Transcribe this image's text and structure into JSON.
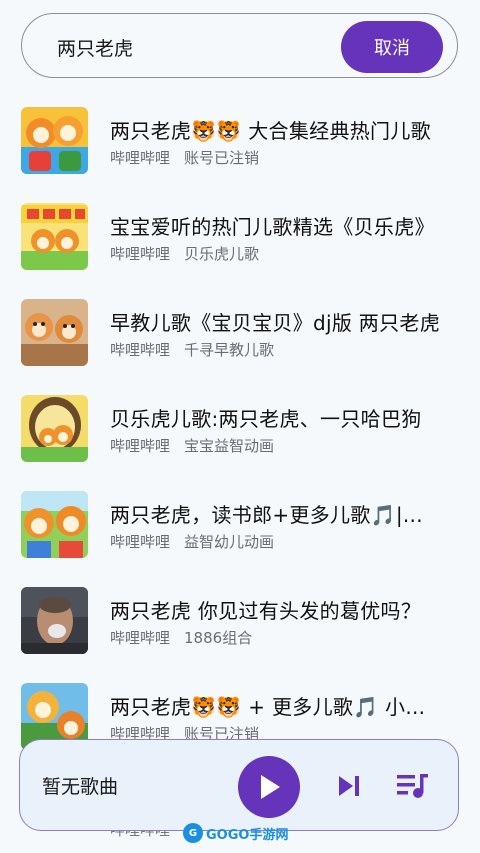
{
  "search": {
    "value": "两只老虎",
    "cancel_label": "取消"
  },
  "songs": [
    {
      "title": "两只老虎🐯🐯 大合集经典热门儿歌",
      "source": "哔哩哔哩",
      "artist": "账号已注销"
    },
    {
      "title": "宝宝爱听的热门儿歌精选《贝乐虎》",
      "source": "哔哩哔哩",
      "artist": "贝乐虎儿歌"
    },
    {
      "title": "早教儿歌《宝贝宝贝》dj版 两只老虎",
      "source": "哔哩哔哩",
      "artist": "千寻早教儿歌"
    },
    {
      "title": "贝乐虎儿歌:两只老虎、一只哈巴狗",
      "source": "哔哩哔哩",
      "artist": "宝宝益智动画"
    },
    {
      "title": "两只老虎，读书郎+更多儿歌🎵|...",
      "source": "哔哩哔哩",
      "artist": "益智幼儿动画"
    },
    {
      "title": "两只老虎 你见过有头发的葛优吗？",
      "source": "哔哩哔哩",
      "artist": "1886组合"
    },
    {
      "title": "两只老虎🐯🐯 + 更多儿歌🎵 小...",
      "source": "哔哩哔哩",
      "artist": "账号已注销"
    }
  ],
  "under_row_text": "哔哩哔哩",
  "player": {
    "now_playing": "暂无歌曲",
    "play_icon": "play-icon",
    "next_icon": "skip-next-icon",
    "queue_icon": "queue-music-icon"
  },
  "watermark": {
    "text": "GOGO手游网"
  },
  "colors": {
    "accent": "#6633bb",
    "background": "#f5f9fc",
    "player_bg": "#e9f1fb"
  }
}
